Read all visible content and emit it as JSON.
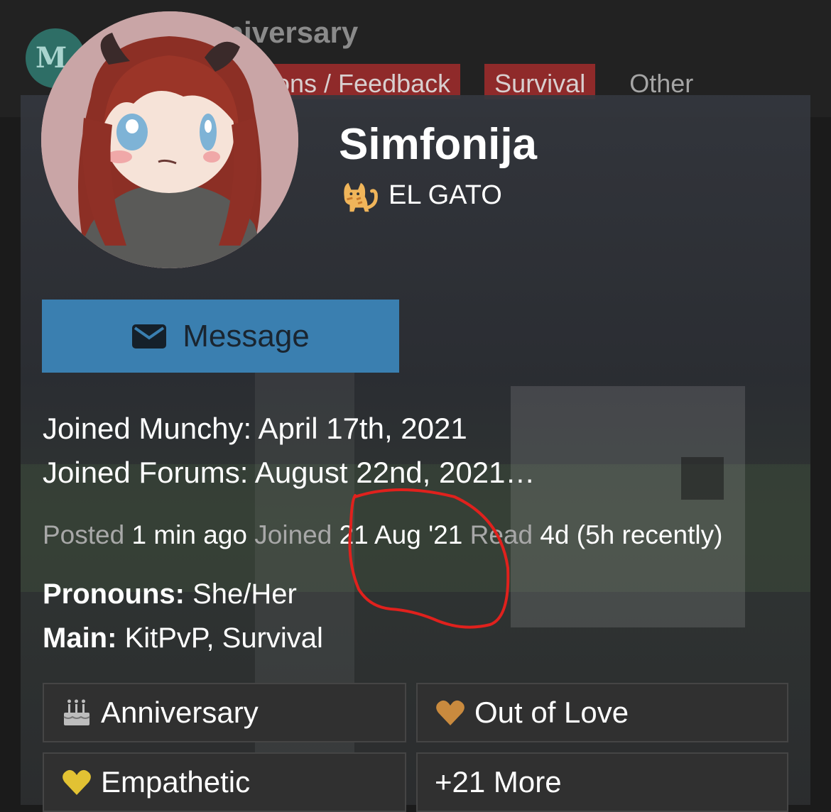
{
  "header": {
    "title": "Mod Anniversary",
    "tabs": [
      "ssions / Feedback",
      "Survival",
      "Other"
    ]
  },
  "profile": {
    "name": "Simfonija",
    "title": "EL GATO",
    "title_icon": "cat-icon",
    "message_label": "Message",
    "joined_munchy": "Joined Munchy: April 17th, 2021",
    "joined_forums": "Joined Forums: August 22nd, 2021…",
    "stats": {
      "posted_label": "Posted",
      "posted_value": "1 min ago",
      "joined_label": "Joined",
      "joined_value": "21 Aug '21",
      "read_label": "Read",
      "read_value": "4d (5h recently)"
    },
    "pronouns_label": "Pronouns:",
    "pronouns_value": "She/Her",
    "main_label": "Main:",
    "main_value": "KitPvP, Survival"
  },
  "badges": [
    {
      "label": "Anniversary",
      "icon": "cake-icon"
    },
    {
      "label": "Out of Love",
      "icon": "heart-icon",
      "color": "#c98a3e"
    },
    {
      "label": "Empathetic",
      "icon": "heart-icon",
      "color": "#e2c233"
    },
    {
      "label": "+21 More"
    }
  ],
  "colors": {
    "message_button": "#3a7fb0",
    "annotation": "#e0211d"
  }
}
